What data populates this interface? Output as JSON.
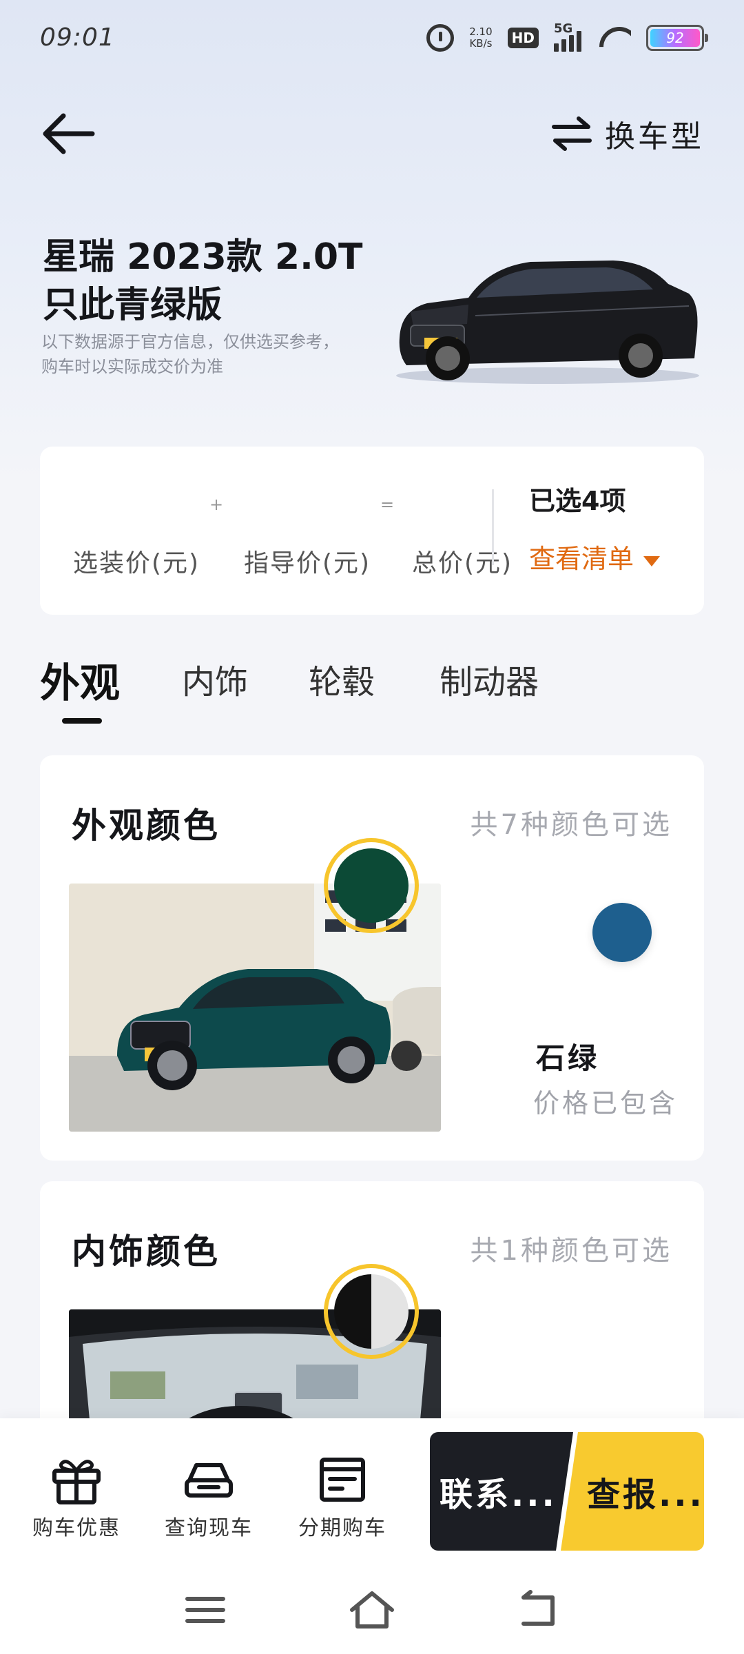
{
  "status_bar": {
    "time": "09:01",
    "net_speed_value": "2.10",
    "net_speed_unit": "KB/s",
    "hd_label": "HD",
    "signal_label": "5G",
    "battery_level": "92"
  },
  "nav": {
    "switch_model_label": "换车型"
  },
  "hero": {
    "model_title_line1": "星瑞 2023款 2.0T",
    "model_title_line2": "只此青绿版",
    "disclaimer": "以下数据源于官方信息，仅供选买参考，购车时以实际成交价为准"
  },
  "price": {
    "option_price_label": "选装价(元)",
    "guide_price_label": "指导价(元)",
    "total_price_label": "总价(元)",
    "plus_sign": "+",
    "equals_sign": "=",
    "selected_count": "已选4项",
    "view_list_label": "查看清单"
  },
  "tabs": [
    {
      "label": "外观",
      "active": true
    },
    {
      "label": "内饰",
      "active": false
    },
    {
      "label": "轮毂",
      "active": false
    },
    {
      "label": "制动器",
      "active": false
    }
  ],
  "exterior": {
    "title": "外观颜色",
    "count_text": "共7种颜色可选",
    "selected_color_name": "石绿",
    "price_note": "价格已包含",
    "swatches": [
      "#0c4a36",
      "#1e5f8e"
    ]
  },
  "interior": {
    "title": "内饰颜色",
    "count_text": "共1种颜色可选",
    "swatches": [
      "#111111",
      "#e4e4e4"
    ]
  },
  "actions": {
    "deals_label": "购车优惠",
    "stock_label": "查询现车",
    "installment_label": "分期购车",
    "contact_label": "联系...",
    "report_label": "查报..."
  },
  "colors": {
    "accent_orange": "#e06a12",
    "selected_ring": "#f7c52c",
    "dark_button": "#1c1e24",
    "yellow_button": "#f8ca2f"
  }
}
